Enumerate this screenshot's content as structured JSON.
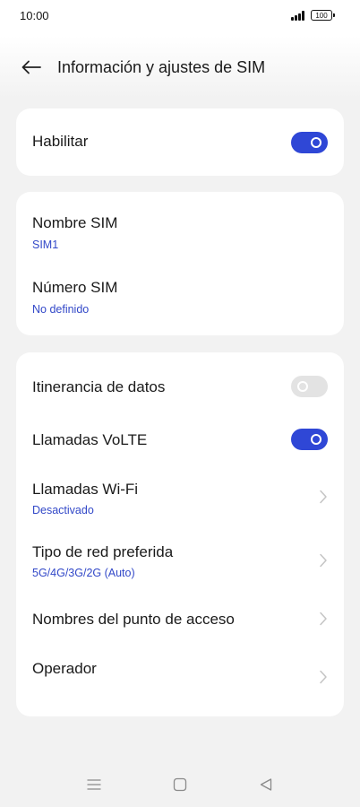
{
  "status_bar": {
    "time": "10:00",
    "battery": "100"
  },
  "header": {
    "title": "Información y ajustes de SIM"
  },
  "card_enable": {
    "label": "Habilitar",
    "enabled": true
  },
  "card_sim": {
    "name_label": "Nombre SIM",
    "name_value": "SIM1",
    "number_label": "Número SIM",
    "number_value": "No definido"
  },
  "card_settings": {
    "roaming_label": "Itinerancia de datos",
    "roaming_enabled": false,
    "volte_label": "Llamadas VoLTE",
    "volte_enabled": true,
    "wifi_label": "Llamadas Wi-Fi",
    "wifi_value": "Desactivado",
    "network_label": "Tipo de red preferida",
    "network_value": "5G/4G/3G/2G (Auto)",
    "apn_label": "Nombres del punto de acceso",
    "operator_label": "Operador"
  },
  "colors": {
    "accent": "#2f47d6",
    "subtext": "#3248c8",
    "background": "#f2f2f2"
  },
  "icons": {
    "back": "back-arrow-icon",
    "chevron": "chevron-right-icon",
    "nav": [
      "menu-icon",
      "home-icon",
      "back-triangle-icon"
    ]
  }
}
